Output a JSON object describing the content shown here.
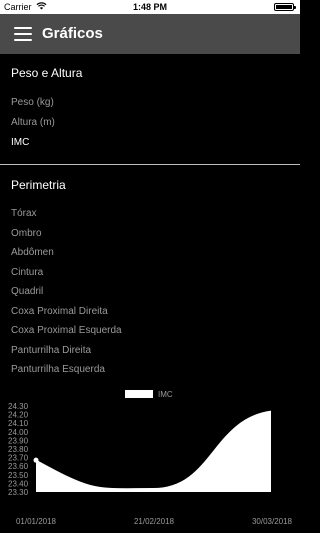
{
  "status_bar": {
    "carrier": "Carrier",
    "time": "1:48 PM"
  },
  "header": {
    "title": "Gráficos"
  },
  "sections": {
    "peso_altura": {
      "title": "Peso e Altura",
      "items": [
        {
          "label": "Peso (kg)",
          "active": false
        },
        {
          "label": "Altura (m)",
          "active": false
        },
        {
          "label": "IMC",
          "active": true
        }
      ]
    },
    "perimetria": {
      "title": "Perimetria",
      "items": [
        {
          "label": "Tórax"
        },
        {
          "label": "Ombro"
        },
        {
          "label": "Abdômen"
        },
        {
          "label": "Cintura"
        },
        {
          "label": "Quadril"
        },
        {
          "label": "Coxa Proximal Direita"
        },
        {
          "label": "Coxa Proximal Esquerda"
        },
        {
          "label": "Panturrilha Direita"
        },
        {
          "label": "Panturrilha Esquerda"
        }
      ]
    }
  },
  "colors": {
    "app_bar": "#4a4a4a",
    "background": "#000000",
    "inactive_text": "#9a9a9a",
    "chart_fill": "#ffffff"
  },
  "chart_data": {
    "type": "area",
    "legend": "IMC",
    "legend_position": "top-center",
    "x": [
      "01/01/2018",
      "21/02/2018",
      "30/03/2018"
    ],
    "x_tick_labels": [
      "01/01/2018",
      "21/02/2018",
      "30/03/2018"
    ],
    "series": [
      {
        "name": "IMC",
        "values": [
          23.67,
          23.34,
          24.24
        ]
      }
    ],
    "y_ticks": [
      "24.30",
      "24.20",
      "24.10",
      "24.00",
      "23.90",
      "23.80",
      "23.70",
      "23.60",
      "23.50",
      "23.40",
      "23.30"
    ],
    "ylim": [
      23.3,
      24.3
    ],
    "grid": false
  }
}
